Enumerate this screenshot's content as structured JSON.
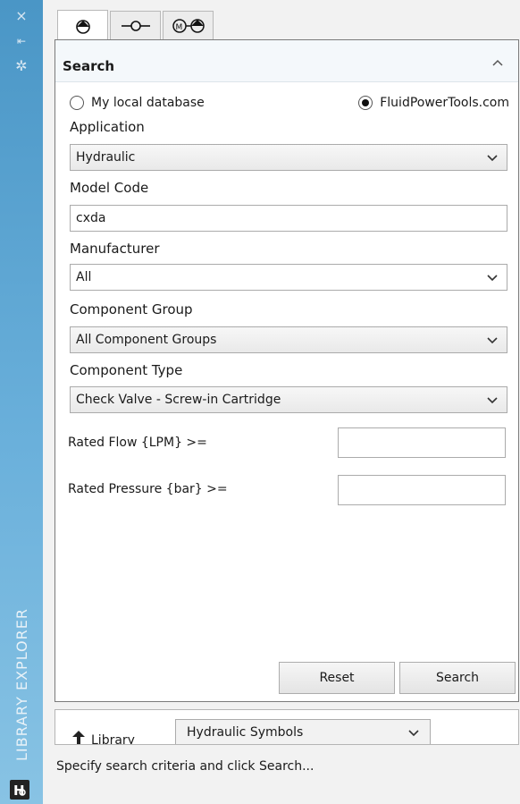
{
  "sidebar": {
    "title": "LIBRARY  EXPLORER",
    "icons": [
      "close-icon",
      "pin-icon",
      "settings-icon"
    ]
  },
  "tabs": [
    {
      "name": "search-tab",
      "icon": "search-symbol-icon",
      "active": true
    },
    {
      "name": "connector-tab",
      "icon": "connector-symbol-icon",
      "active": false
    },
    {
      "name": "motor-pump-tab",
      "icon": "motor-pump-symbol-icon",
      "active": false
    }
  ],
  "search": {
    "title": "Search",
    "radio_local": "My local database",
    "radio_online": "FluidPowerTools.com",
    "selected_source": "FluidPowerTools.com",
    "application_label": "Application",
    "application_value": "Hydraulic",
    "model_code_label": "Model Code",
    "model_code_value": "cxda",
    "manufacturer_label": "Manufacturer",
    "manufacturer_value": "All",
    "component_group_label": "Component Group",
    "component_group_value": "All Component Groups",
    "component_type_label": "Component Type",
    "component_type_value": "Check Valve - Screw-in Cartridge",
    "rated_flow_label": "Rated Flow {LPM}  >=",
    "rated_flow_value": "",
    "rated_pressure_label": "Rated Pressure {bar}  >=",
    "rated_pressure_value": "",
    "reset_label": "Reset",
    "search_label": "Search"
  },
  "library": {
    "label": "Library",
    "value": "Hydraulic Symbols"
  },
  "status": "Specify search criteria and click Search..."
}
